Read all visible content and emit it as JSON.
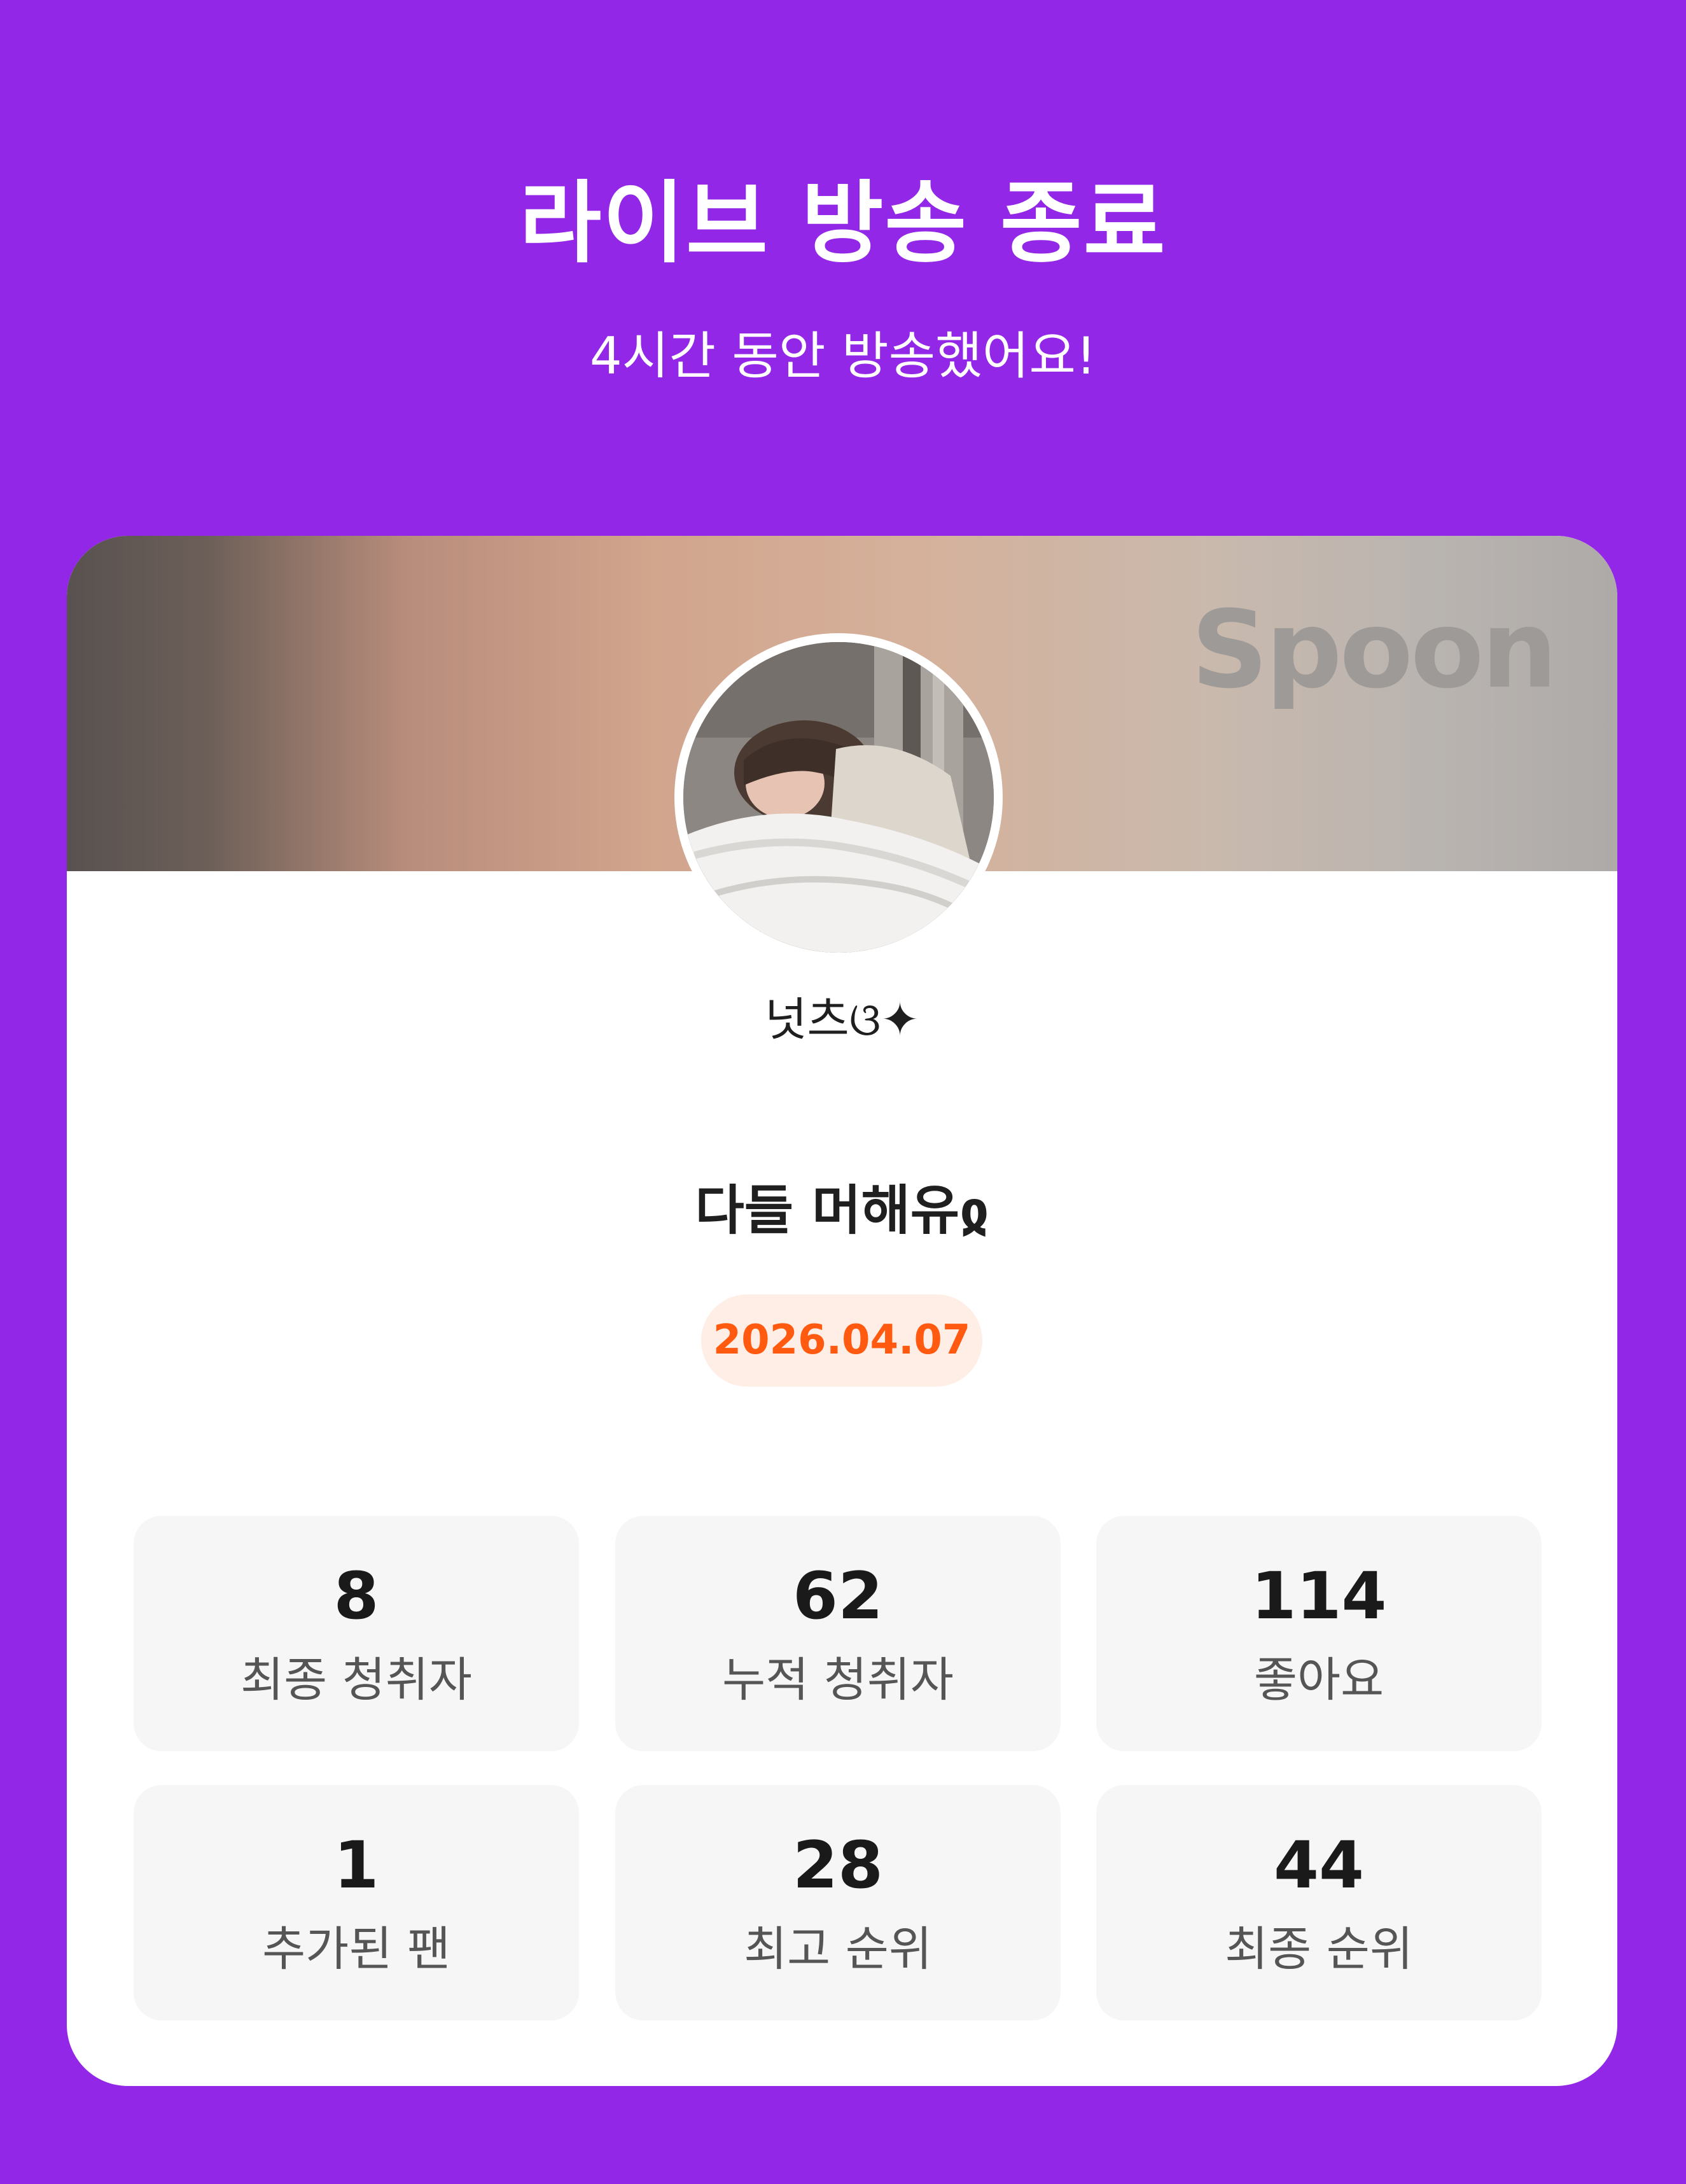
{
  "header": {
    "title": "라이브 방송 종료",
    "subtitle": "4시간 동안 방송했어요!"
  },
  "card": {
    "brand_logo_text": "Spoon",
    "username": "넛츠ଓ✦",
    "room_title": "다들 머해유ჲ",
    "date": "2026.04.07"
  },
  "stats": [
    {
      "value": "8",
      "label": "최종 청취자"
    },
    {
      "value": "62",
      "label": "누적 청취자"
    },
    {
      "value": "114",
      "label": "좋아요"
    },
    {
      "value": "1",
      "label": "추가된 팬"
    },
    {
      "value": "28",
      "label": "최고 순위"
    },
    {
      "value": "44",
      "label": "최종 순위"
    }
  ],
  "colors": {
    "background": "#9327e8",
    "card": "#ffffff",
    "date_text": "#ff5a10",
    "date_badge": "#ffeee6",
    "stat_tile": "#f6f6f6"
  }
}
